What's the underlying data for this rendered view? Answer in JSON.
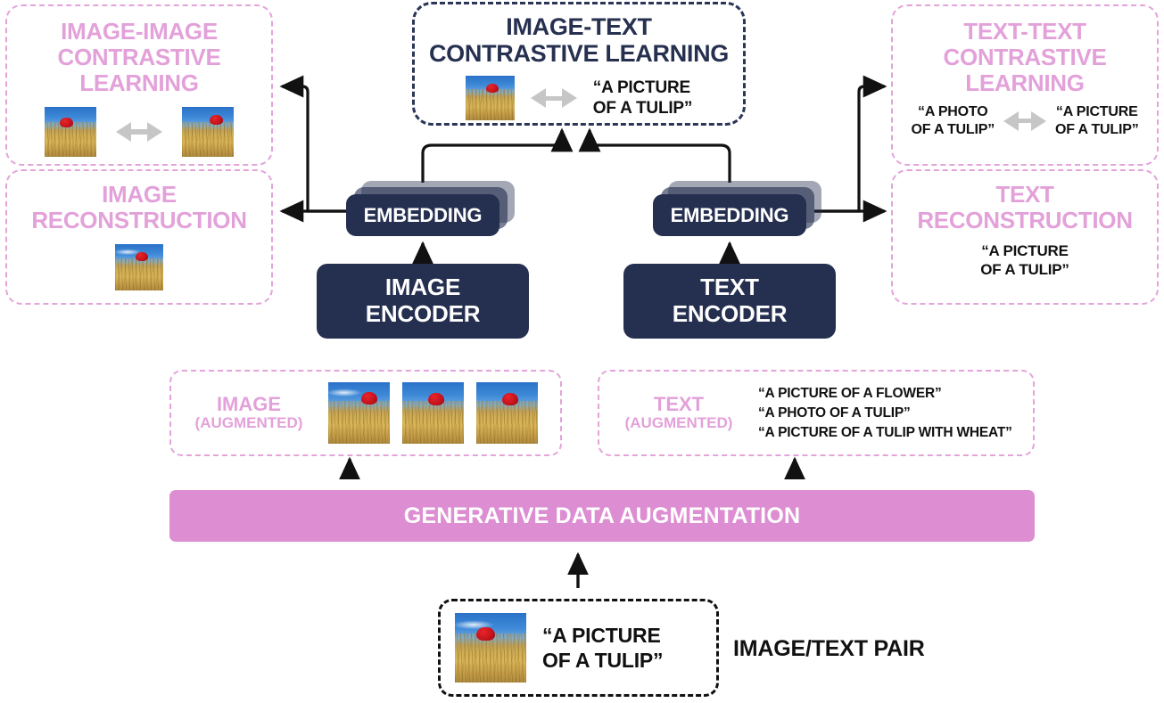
{
  "colors": {
    "pink_text": "#e3a1da",
    "pink_bar": "#dd8ed2",
    "navy": "#252f50",
    "gray_arrow": "#c6c6c6",
    "black": "#111111"
  },
  "panels": {
    "image_image_contrastive": {
      "title_lines": [
        "IMAGE-IMAGE",
        "CONTRASTIVE",
        "LEARNING"
      ],
      "left_image": "tulip-in-wheat-image",
      "arrow": "gray-double-arrow",
      "right_image": "tulip-in-wheat-image"
    },
    "image_reconstruction": {
      "title_lines": [
        "IMAGE",
        "RECONSTRUCTION"
      ],
      "image": "tulip-in-wheat-image"
    },
    "image_text_contrastive": {
      "title_lines": [
        "IMAGE-TEXT",
        "CONTRASTIVE LEARNING"
      ],
      "image": "tulip-in-wheat-image",
      "arrow": "gray-double-arrow",
      "caption_lines": [
        "“A PICTURE",
        "OF A TULIP”"
      ]
    },
    "text_text_contrastive": {
      "title_lines": [
        "TEXT-TEXT",
        "CONTRASTIVE",
        "LEARNING"
      ],
      "left_caption_lines": [
        "“A PHOTO",
        "OF A TULIP”"
      ],
      "arrow": "gray-double-arrow",
      "right_caption_lines": [
        "“A PICTURE",
        "OF A TULIP”"
      ]
    },
    "text_reconstruction": {
      "title_lines": [
        "TEXT",
        "RECONSTRUCTION"
      ],
      "caption_lines": [
        "“A PICTURE",
        "OF A TULIP”"
      ]
    }
  },
  "pipeline": {
    "image_embedding_label": "EMBEDDING",
    "text_embedding_label": "EMBEDDING",
    "image_encoder_lines": [
      "IMAGE",
      "ENCODER"
    ],
    "text_encoder_lines": [
      "TEXT",
      "ENCODER"
    ],
    "image_augmented_label": "IMAGE",
    "image_augmented_sub": "(AUGMENTED)",
    "augmented_images": [
      "tulip-in-wheat-image-1",
      "tulip-in-wheat-image-2",
      "tulip-in-wheat-image-3"
    ],
    "text_augmented_label": "TEXT",
    "text_augmented_sub": "(AUGMENTED)",
    "augmented_texts": [
      "“A PICTURE OF A FLOWER”",
      "“A PHOTO OF A TULIP”",
      "“A PICTURE OF A TULIP WITH WHEAT”"
    ],
    "generative_bar_label": "GENERATIVE DATA AUGMENTATION",
    "pair_image": "tulip-in-wheat-image",
    "pair_caption_lines": [
      "“A PICTURE",
      "OF A TULIP”"
    ],
    "pair_label": "IMAGE/TEXT PAIR"
  }
}
